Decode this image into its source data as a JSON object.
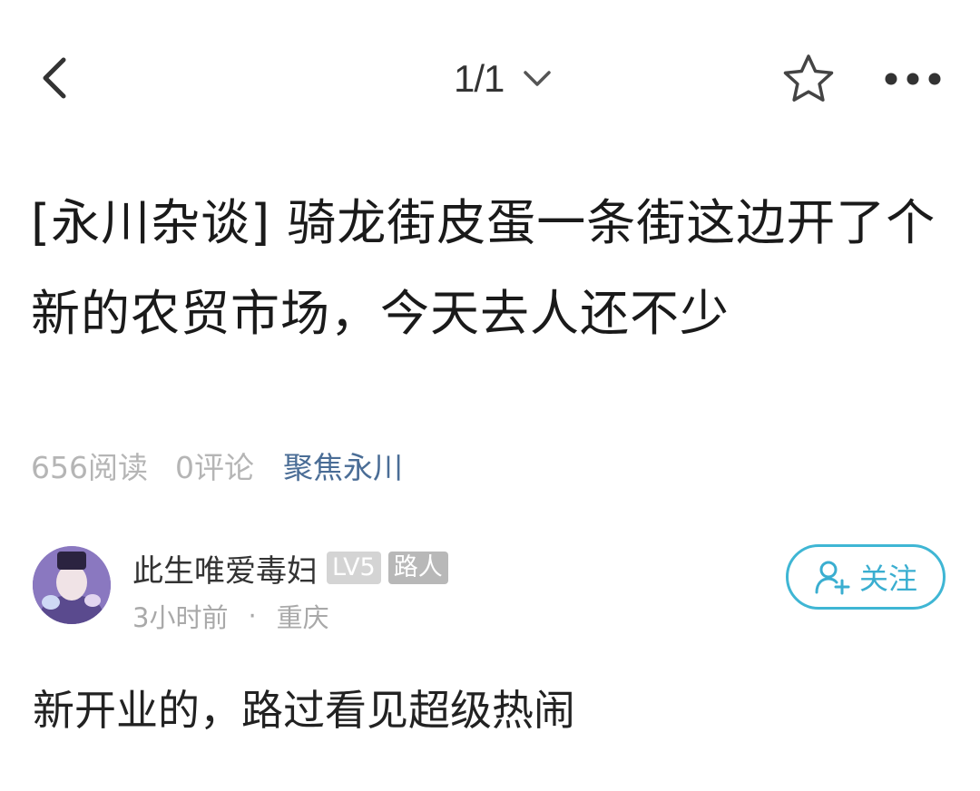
{
  "nav": {
    "back_icon": "chevron-left-icon",
    "pager": "1/1",
    "pager_icon": "chevron-down-icon",
    "favorite_icon": "star-icon",
    "more_icon": "more-dots-icon"
  },
  "post": {
    "title": "[永川杂谈] 骑龙街皮蛋一条街这边开了个新的农贸市场，今天去人还不少",
    "reads": "656阅读",
    "comments": "0评论",
    "topic": "聚焦永川",
    "body": "新开业的，路过看见超级热闹"
  },
  "author": {
    "name": "此生唯爱毒妇",
    "level": "LV5",
    "role": "路人",
    "time": "3小时前",
    "separator": "·",
    "location": "重庆",
    "follow_label": "关注",
    "follow_icon": "add-user-icon"
  },
  "colors": {
    "accent": "#3fb6d4",
    "topic": "#4a6d96",
    "meta_gray": "#b5b5b5"
  }
}
